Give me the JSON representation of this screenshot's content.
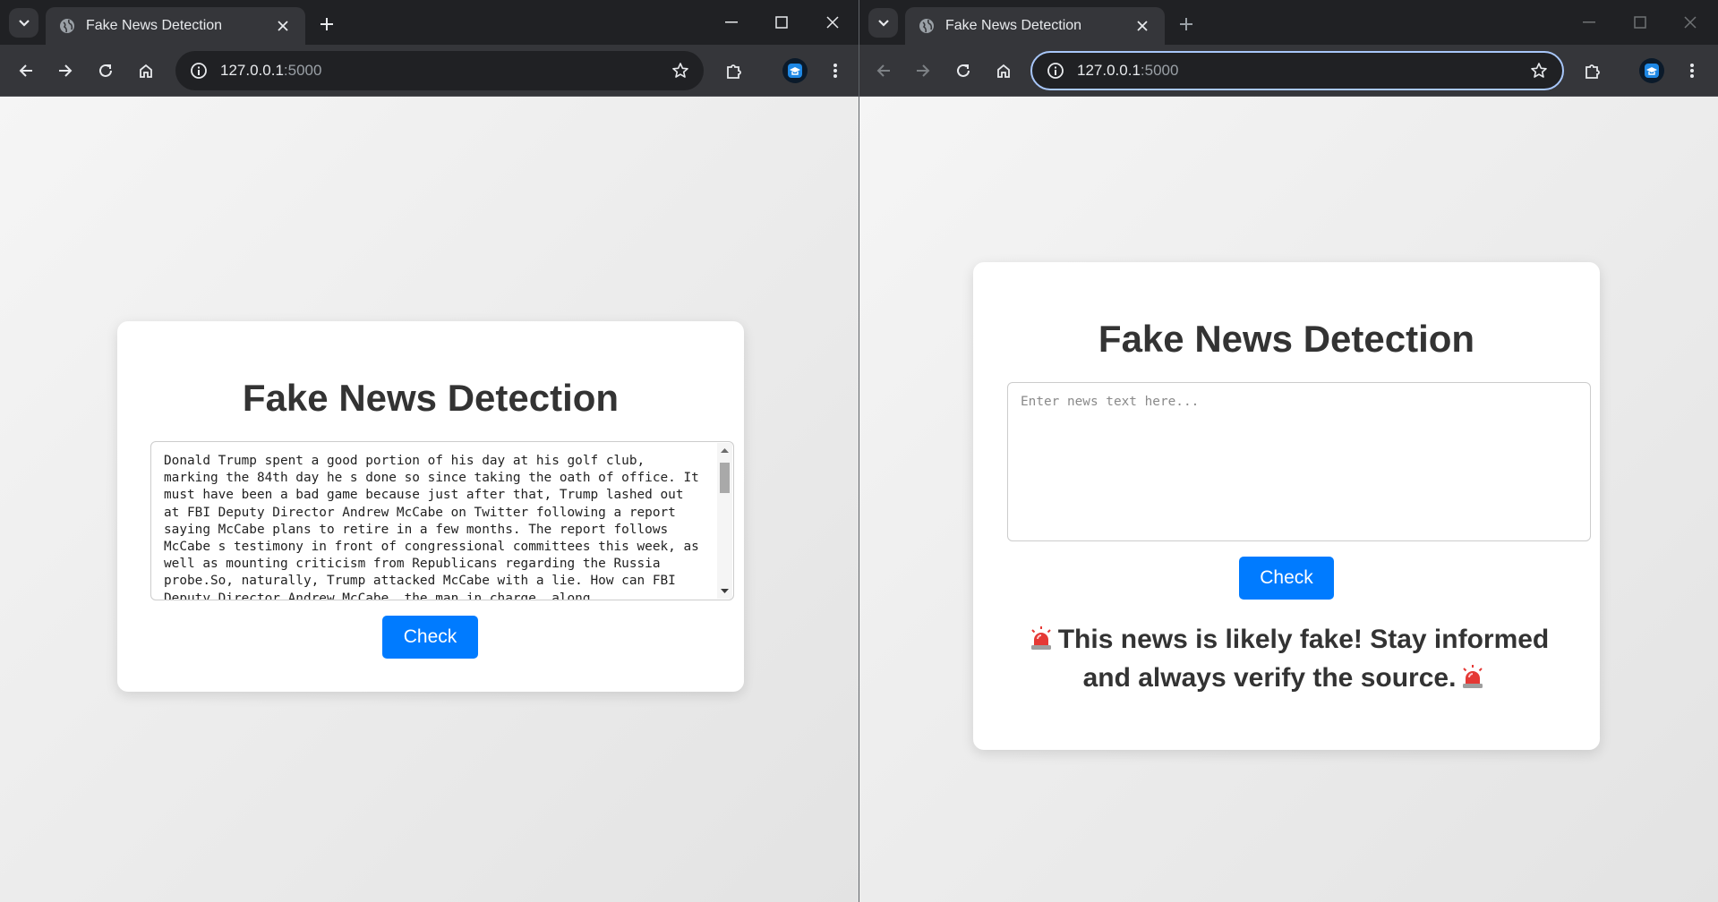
{
  "left_window": {
    "tab_title": "Fake News Detection",
    "url_host": "127.0.0.1",
    "url_port": ":5000",
    "page": {
      "heading": "Fake News Detection",
      "textarea_value": "Donald Trump spent a good portion of his day at his golf club, marking the 84th day he s done so since taking the oath of office. It must have been a bad game because just after that, Trump lashed out at FBI Deputy Director Andrew McCabe on Twitter following a report saying McCabe plans to retire in a few months. The report follows McCabe s testimony in front of congressional committees this week, as well as mounting criticism from Republicans regarding the Russia probe.So, naturally, Trump attacked McCabe with a lie. How can FBI Deputy Director Andrew McCabe, the man in charge, along",
      "button_label": "Check"
    }
  },
  "right_window": {
    "tab_title": "Fake News Detection",
    "url_host": "127.0.0.1",
    "url_port": ":5000",
    "page": {
      "heading": "Fake News Detection",
      "textarea_placeholder": "Enter news text here...",
      "button_label": "Check",
      "result_text": "This news is likely fake! Stay informed and always verify the source."
    }
  },
  "icons": {
    "tab_search": "chevron-down-icon",
    "favicon": "globe-icon",
    "tab_close": "close-icon",
    "new_tab": "plus-icon",
    "back": "arrow-left-icon",
    "forward": "arrow-right-icon",
    "reload": "reload-icon",
    "home": "home-icon",
    "site_info": "info-icon",
    "bookmark": "star-icon",
    "extensions": "puzzle-icon",
    "menu": "kebab-menu-icon",
    "alarm": "siren-icon"
  },
  "colors": {
    "accent_button": "#007bff",
    "heading": "#333333",
    "browser_frame": "#202124",
    "toolbar": "#35363a"
  }
}
